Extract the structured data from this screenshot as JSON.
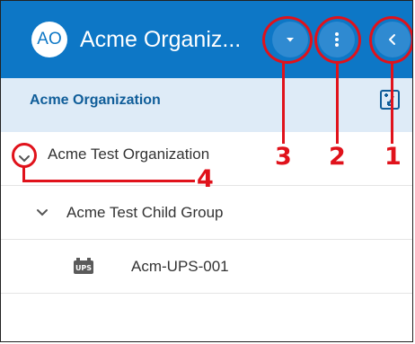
{
  "header": {
    "avatar_initials": "AO",
    "title": "Acme Organiz...",
    "colors": {
      "header_bg": "#0d77c6",
      "button_bg": "#2f8ad1"
    },
    "icons": [
      "dropdown-caret-icon",
      "more-vertical-icon",
      "collapse-panel-icon"
    ]
  },
  "subheader": {
    "label": "Acme Organization",
    "icon": "tree-expand-icon"
  },
  "tree": {
    "items": [
      {
        "label": "Acme Test Organization",
        "icon": "chevron-down-icon"
      },
      {
        "label": "Acme Test Child Group",
        "icon": "chevron-down-icon"
      },
      {
        "label": "Acm-UPS-001",
        "icon": "ups-device-icon",
        "icon_text": "UPS"
      }
    ]
  },
  "callouts": [
    {
      "number": "1",
      "target": "collapse-panel-button"
    },
    {
      "number": "2",
      "target": "more-options-button"
    },
    {
      "number": "3",
      "target": "organization-dropdown-button"
    },
    {
      "number": "4",
      "target": "tree-toggle-organization"
    }
  ],
  "annotation_color": "#e0121b"
}
